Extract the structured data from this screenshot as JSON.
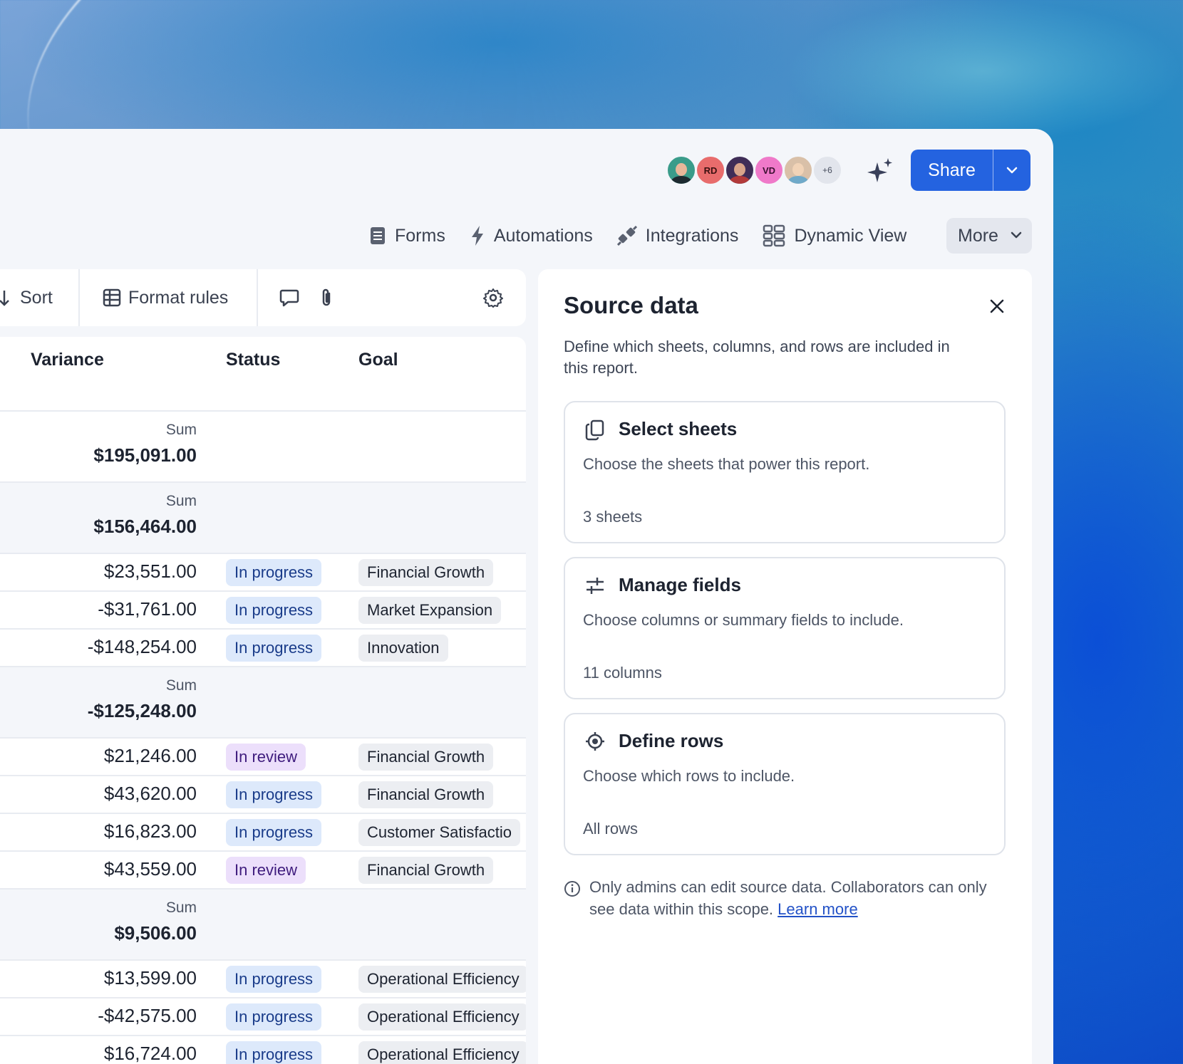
{
  "header": {
    "avatars": [
      {
        "initials": "",
        "kind": "photo"
      },
      {
        "initials": "RD",
        "kind": "initials"
      },
      {
        "initials": "",
        "kind": "photo"
      },
      {
        "initials": "VD",
        "kind": "initials"
      },
      {
        "initials": "",
        "kind": "photo"
      },
      {
        "initials": "+6",
        "kind": "overflow"
      }
    ],
    "share_label": "Share",
    "accent_color": "#2463e0"
  },
  "nav": {
    "forms": "Forms",
    "automations": "Automations",
    "integrations": "Integrations",
    "dynamic_view": "Dynamic View",
    "more": "More"
  },
  "toolbar": {
    "sort": "Sort",
    "format_rules": "Format rules"
  },
  "grid": {
    "columns": {
      "variance": "Variance",
      "status": "Status",
      "goal": "Goal"
    },
    "sum_label": "Sum",
    "rows": [
      {
        "type": "sum",
        "value": "$195,091.00"
      },
      {
        "type": "sum",
        "value": "$156,464.00"
      },
      {
        "type": "data",
        "value": "$23,551.00",
        "status": "In progress",
        "goal": "Financial Growth"
      },
      {
        "type": "data",
        "value": "-$31,761.00",
        "status": "In progress",
        "goal": "Market Expansion"
      },
      {
        "type": "data",
        "value": "-$148,254.00",
        "status": "In progress",
        "goal": "Innovation"
      },
      {
        "type": "sum",
        "value": "-$125,248.00"
      },
      {
        "type": "data",
        "value": "$21,246.00",
        "status": "In review",
        "goal": "Financial Growth"
      },
      {
        "type": "data",
        "value": "$43,620.00",
        "status": "In progress",
        "goal": "Financial Growth"
      },
      {
        "type": "data",
        "value": "$16,823.00",
        "status": "In progress",
        "goal": "Customer Satisfactio"
      },
      {
        "type": "data",
        "value": "$43,559.00",
        "status": "In review",
        "goal": "Financial Growth"
      },
      {
        "type": "sum",
        "value": "$9,506.00"
      },
      {
        "type": "data",
        "value": "$13,599.00",
        "status": "In progress",
        "goal": "Operational Efficiency"
      },
      {
        "type": "data",
        "value": "-$42,575.00",
        "status": "In progress",
        "goal": "Operational Efficiency"
      },
      {
        "type": "data",
        "value": "$16,724.00",
        "status": "In progress",
        "goal": "Operational Efficiency"
      }
    ]
  },
  "panel": {
    "title": "Source data",
    "description": "Define which sheets, columns, and rows are included in this report.",
    "cards": [
      {
        "title": "Select sheets",
        "description": "Choose the sheets that power this report.",
        "meta": "3 sheets",
        "icon": "copy-icon"
      },
      {
        "title": "Manage fields",
        "description": "Choose columns or summary fields to include.",
        "meta": "11 columns",
        "icon": "sliders-icon"
      },
      {
        "title": "Define rows",
        "description": "Choose which rows to include.",
        "meta": "All rows",
        "icon": "target-icon"
      }
    ],
    "note": "Only admins can edit source data. Collaborators can only see data within this scope.",
    "learn_more": "Learn more"
  }
}
